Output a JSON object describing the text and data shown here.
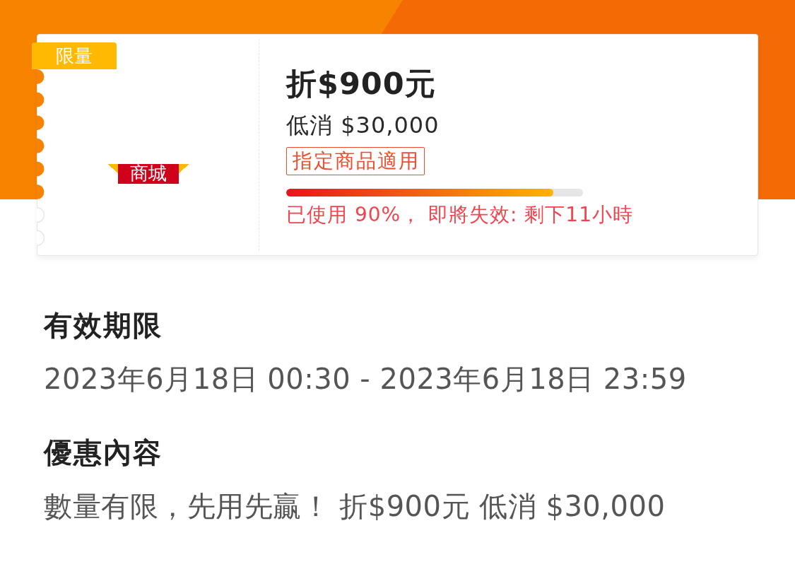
{
  "coupon": {
    "badge": "限量",
    "shop_label": "商城",
    "title": "折$900元",
    "min_spend": "低消 $30,000",
    "tag": "指定商品適用",
    "usage": {
      "level": 0.9
    },
    "status": "已使用 90%， 即將失效: 剩下11小時"
  },
  "sections": [
    {
      "heading": "有效期限",
      "text": "2023年6月18日 00:30 - 2023年6月18日 23:59"
    },
    {
      "heading": "優惠內容",
      "text": "數量有限，先用先贏！ 折$900元 低消 $30,000"
    }
  ]
}
